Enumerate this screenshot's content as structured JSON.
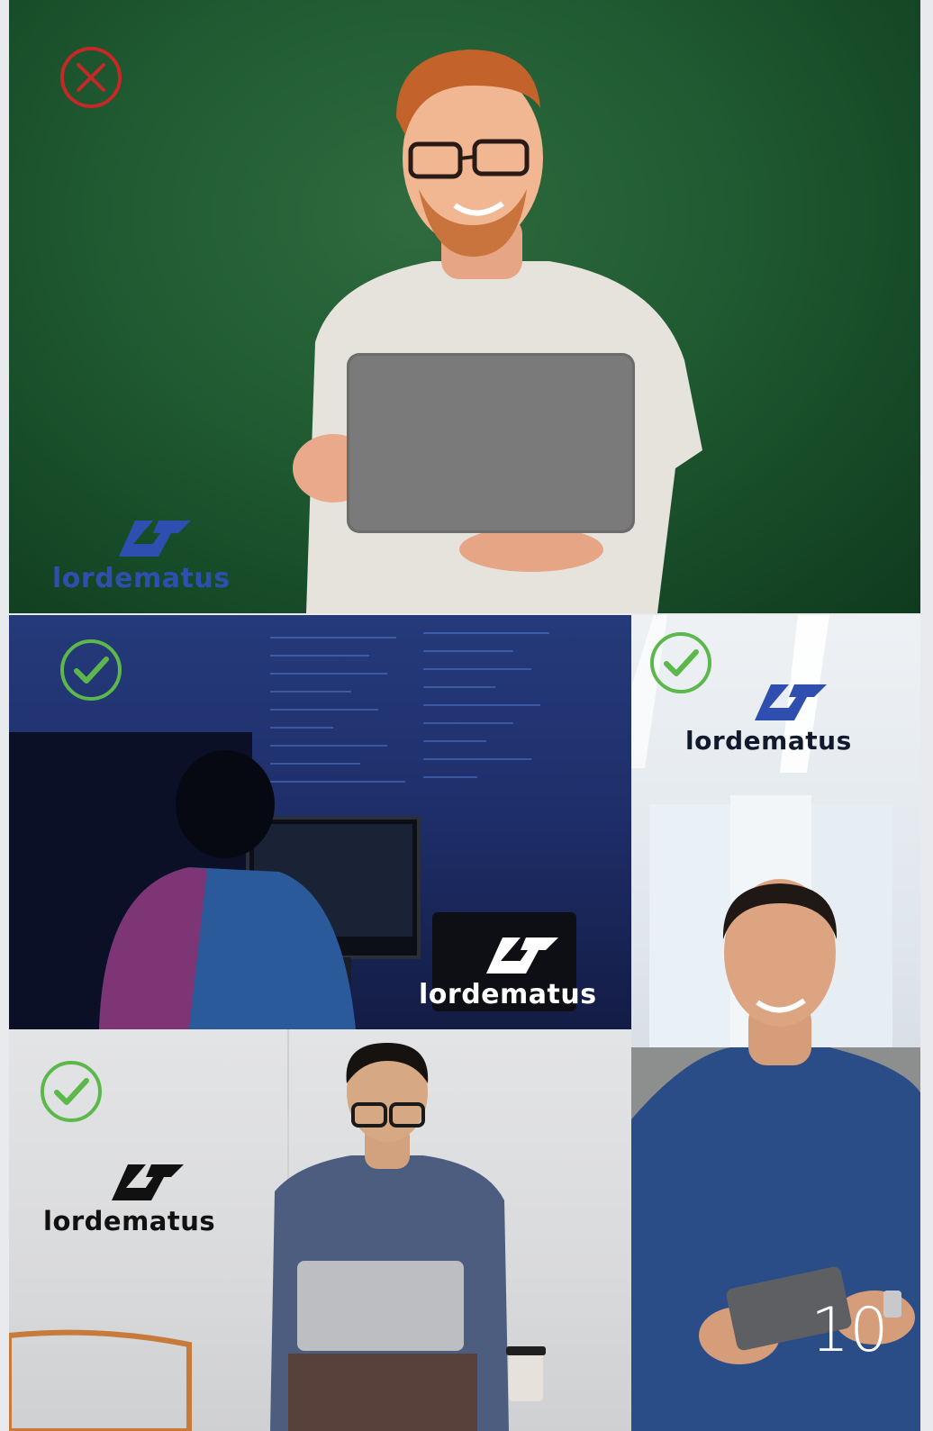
{
  "brand": {
    "name": "lordematus",
    "primary_color": "#2f4fb0",
    "dark_color": "#111a2c",
    "white_color": "#ffffff",
    "black_color": "#111111"
  },
  "examples": [
    {
      "status": "incorrect",
      "status_icon": "cross-circle-icon",
      "status_color": "#c62828"
    },
    {
      "status": "correct",
      "status_icon": "check-circle-icon",
      "status_color": "#5cb84a"
    },
    {
      "status": "correct",
      "status_icon": "check-circle-icon",
      "status_color": "#5cb84a"
    },
    {
      "status": "correct",
      "status_icon": "check-circle-icon",
      "status_color": "#5cb84a"
    }
  ],
  "page_number": "10"
}
